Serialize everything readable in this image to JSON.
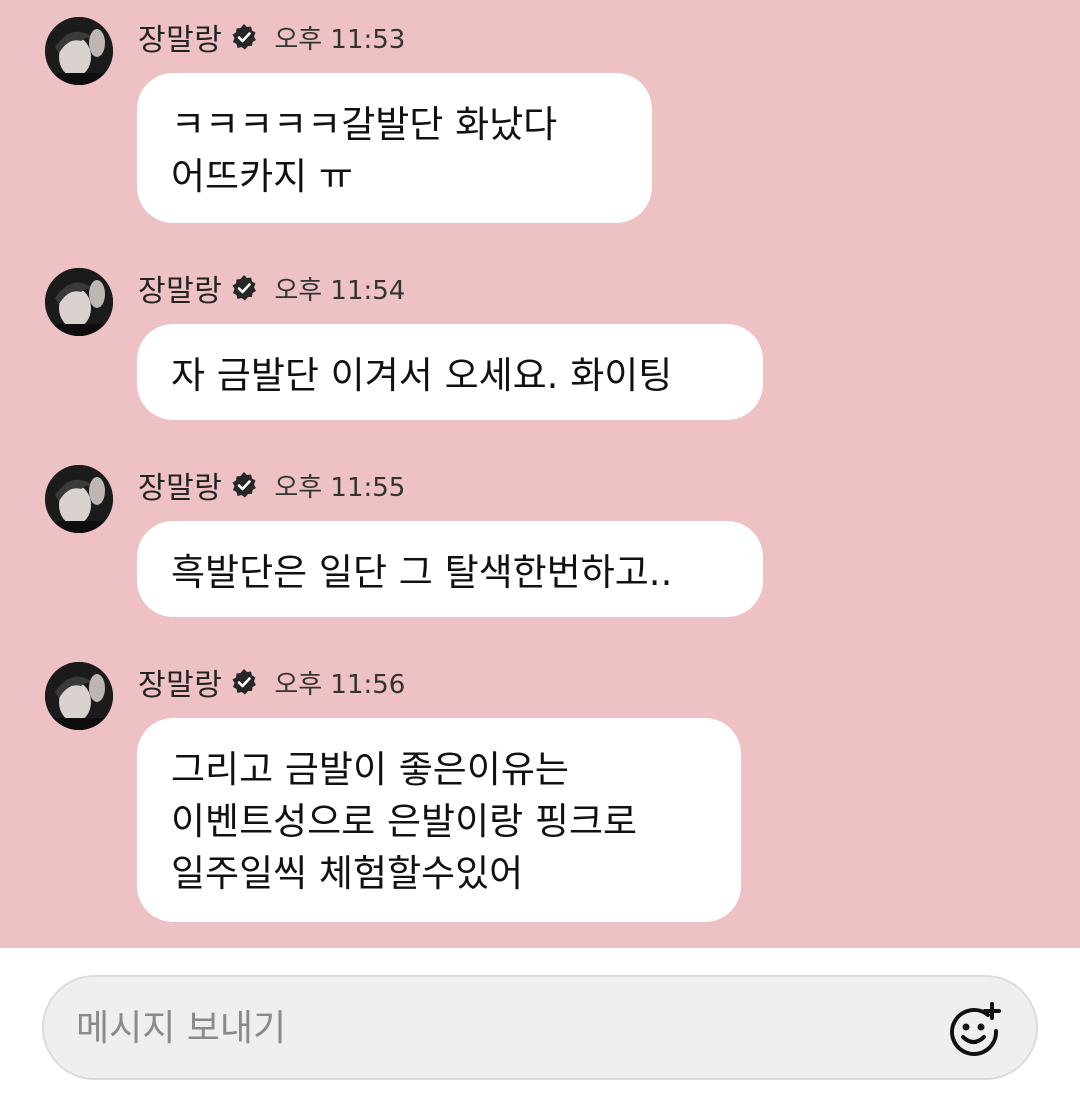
{
  "messages": [
    {
      "sender": "장말랑",
      "time": "오후 11:53",
      "text": "ㅋㅋㅋㅋㅋ갈발단 화났다\n어뜨카지 ㅠ"
    },
    {
      "sender": "장말랑",
      "time": "오후 11:54",
      "text": "자 금발단 이겨서 오세요. 화이팅"
    },
    {
      "sender": "장말랑",
      "time": "오후 11:55",
      "text": "흑발단은 일단 그 탈색한번하고.."
    },
    {
      "sender": "장말랑",
      "time": "오후 11:56",
      "text": "그리고 금발이 좋은이유는\n이벤트성으로 은발이랑 핑크로\n일주일씩 체험할수있어"
    }
  ],
  "composer": {
    "placeholder": "메시지 보내기"
  },
  "icons": {
    "verified": "verified-badge-icon",
    "emoji": "add-emoji-icon"
  },
  "colors": {
    "chat_background": "#eec1c4",
    "bubble": "#ffffff",
    "composer_background": "#efefef"
  }
}
